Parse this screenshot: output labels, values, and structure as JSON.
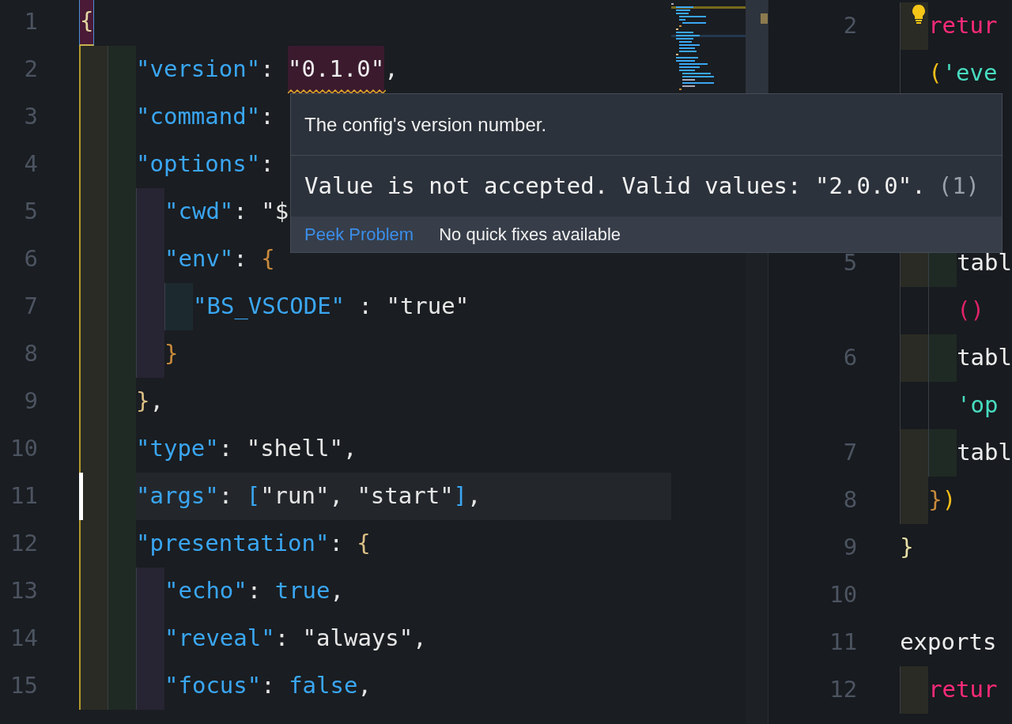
{
  "left_editor": {
    "lines": [
      {
        "number": "1",
        "guide_active": true,
        "tokens": [
          {
            "kind": "brace-match",
            "text": "{"
          }
        ],
        "children": [
          {
            "number": "2",
            "tokens": [
              {
                "kind": "key",
                "text": "\"version\""
              },
              {
                "kind": "punct",
                "text": ": "
              },
              {
                "kind": "error",
                "text": "\"0.1.0\""
              },
              {
                "kind": "punct",
                "text": ","
              }
            ]
          },
          {
            "number": "3",
            "tokens": [
              {
                "kind": "key",
                "text": "\"command\""
              },
              {
                "kind": "punct",
                "text": ":"
              }
            ]
          },
          {
            "number": "4",
            "tokens": [
              {
                "kind": "key",
                "text": "\"options\""
              },
              {
                "kind": "punct",
                "text": ":"
              }
            ],
            "children": [
              {
                "number": "5",
                "tokens": [
                  {
                    "kind": "key",
                    "text": "\"cwd\""
                  },
                  {
                    "kind": "punct",
                    "text": ": "
                  },
                  {
                    "kind": "string",
                    "text": "\"$"
                  }
                ]
              },
              {
                "number": "6",
                "tokens": [
                  {
                    "kind": "key",
                    "text": "\"env\""
                  },
                  {
                    "kind": "punct",
                    "text": ": "
                  },
                  {
                    "kind": "bracket-orange",
                    "text": "{"
                  }
                ],
                "children": [
                  {
                    "number": "7",
                    "tokens": [
                      {
                        "kind": "key",
                        "text": "\"BS_VSCODE\""
                      },
                      {
                        "kind": "punct",
                        "text": " : "
                      },
                      {
                        "kind": "string",
                        "text": "\"true\""
                      }
                    ]
                  }
                ]
              },
              {
                "number": "8",
                "tokens": [
                  {
                    "kind": "bracket-orange",
                    "text": "}"
                  }
                ]
              }
            ]
          },
          {
            "number": "9",
            "tokens": [
              {
                "kind": "bracket-gold",
                "text": "}"
              },
              {
                "kind": "punct",
                "text": ","
              }
            ]
          },
          {
            "number": "10",
            "tokens": [
              {
                "kind": "key",
                "text": "\"type\""
              },
              {
                "kind": "punct",
                "text": ": "
              },
              {
                "kind": "string",
                "text": "\"shell\""
              },
              {
                "kind": "punct",
                "text": ","
              }
            ]
          },
          {
            "number": "11",
            "current": true,
            "tokens": [
              {
                "kind": "key",
                "text": "\"args\""
              },
              {
                "kind": "punct",
                "text": ": "
              },
              {
                "kind": "bracket-blue",
                "text": "["
              },
              {
                "kind": "string",
                "text": "\"run\""
              },
              {
                "kind": "punct",
                "text": ", "
              },
              {
                "kind": "string",
                "text": "\"start\""
              },
              {
                "kind": "bracket-blue",
                "text": "]"
              },
              {
                "kind": "punct",
                "text": ","
              }
            ]
          },
          {
            "number": "12",
            "tokens": [
              {
                "kind": "key",
                "text": "\"presentation\""
              },
              {
                "kind": "punct",
                "text": ": "
              },
              {
                "kind": "bracket-gold",
                "text": "{"
              }
            ],
            "children": [
              {
                "number": "13",
                "tokens": [
                  {
                    "kind": "key",
                    "text": "\"echo\""
                  },
                  {
                    "kind": "punct",
                    "text": ": "
                  },
                  {
                    "kind": "bool",
                    "text": "true"
                  },
                  {
                    "kind": "punct",
                    "text": ","
                  }
                ]
              },
              {
                "number": "14",
                "tokens": [
                  {
                    "kind": "key",
                    "text": "\"reveal\""
                  },
                  {
                    "kind": "punct",
                    "text": ": "
                  },
                  {
                    "kind": "string",
                    "text": "\"always\""
                  },
                  {
                    "kind": "punct",
                    "text": ","
                  }
                ]
              },
              {
                "number": "15",
                "tokens": [
                  {
                    "kind": "key",
                    "text": "\"focus\""
                  },
                  {
                    "kind": "punct",
                    "text": ": "
                  },
                  {
                    "kind": "bool",
                    "text": "false"
                  },
                  {
                    "kind": "punct",
                    "text": ","
                  }
                ]
              }
            ]
          }
        ]
      }
    ]
  },
  "right_editor": {
    "lines": [
      {
        "children": [
          {
            "number": "2",
            "tokens": [
              {
                "kind": "keyword",
                "text": "retur"
              }
            ]
          },
          {
            "tokens": [
              {
                "kind": "paren-yellow",
                "text": "("
              },
              {
                "kind": "string-teal",
                "text": "'eve"
              }
            ],
            "children": [
              {
                "number": "5",
                "tokens": [
                  {
                    "kind": "plain",
                    "text": "tabl"
                  }
                ]
              },
              {
                "tokens": [
                  {
                    "kind": "paren-pink",
                    "text": "()"
                  }
                ]
              },
              {
                "number": "6",
                "tokens": [
                  {
                    "kind": "plain",
                    "text": "tabl"
                  }
                ]
              },
              {
                "tokens": [
                  {
                    "kind": "string-teal",
                    "text": "'op"
                  }
                ]
              },
              {
                "number": "7",
                "tokens": [
                  {
                    "kind": "plain",
                    "text": "tabl"
                  }
                ]
              }
            ]
          },
          {
            "number": "8",
            "tokens": [
              {
                "kind": "bracket-orange",
                "text": "}"
              },
              {
                "kind": "paren-yellow",
                "text": ")"
              }
            ]
          }
        ]
      },
      {
        "number": "9",
        "tokens": [
          {
            "kind": "brace-light",
            "text": "}"
          }
        ]
      },
      {
        "number": "10"
      },
      {
        "number": "11",
        "tokens": [
          {
            "kind": "plain",
            "text": "exports"
          }
        ],
        "children": [
          {
            "number": "12",
            "tokens": [
              {
                "kind": "keyword",
                "text": "retur"
              }
            ]
          }
        ]
      }
    ]
  },
  "hover": {
    "description": "The config's version number.",
    "message": "Value is not accepted. Valid values: \"2.0.0\".",
    "code": "(1)",
    "actions": [
      {
        "kind": "link",
        "label": "Peek Problem"
      },
      {
        "kind": "note",
        "label": "No quick fixes available"
      }
    ]
  }
}
